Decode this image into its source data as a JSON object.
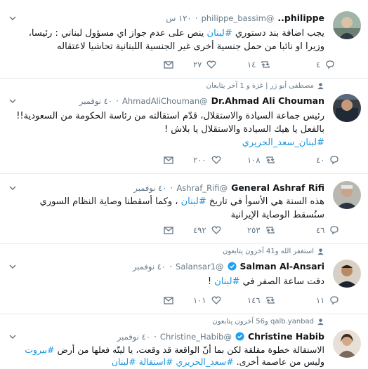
{
  "tweets": [
    {
      "name": "philippe..",
      "handle": "@philippe_bassim",
      "time": "١٢٠ س",
      "text": "يجب اضافة بند دستوري #لبنان ينص على عدم جواز اي مسؤول لبناني : رئيسا، وزيرا او نائبا من حمل جنسية أخرى غير الجنسية اللبنانية تحاشيا لاعتقاله",
      "hashtag": "#لبنان",
      "text_before": "يجب اضافة بند دستوري ",
      "text_after": " ينص على عدم جواز اي مسؤول لبناني : رئيسا، وزيرا او نائبا من حمل جنسية أخرى غير الجنسية اللبنانية تحاشيا لاعتقاله",
      "replies": "٤",
      "retweets": "١٤",
      "likes": "٢٧"
    },
    {
      "social": "مصطفى أبو زر | غزة و 1 آخر يتابعان",
      "name": "Dr.Ahmad Ali Chouman",
      "handle": "@AhmadAliChouman",
      "time": "٤٠ نوفمبر",
      "line1": "رئيس جماعة السيادة والاستقلال، قدّم استقالته من رئاسة الحكومة من السعودية!!",
      "line2": "بالفعل يا هيك السيادة والاستقلال يا بلاش !",
      "hashtags": "#لبنان_سعد_الحريري",
      "replies": "٤٠",
      "retweets": "١٠٨",
      "likes": "٢٠٠"
    },
    {
      "name": "General Ashraf Rifi",
      "handle": "@Ashraf_Rifi",
      "time": "٤٠ نوفمبر",
      "line1_before": "هذه السنة هي الأسوأ في تاريخ ",
      "line1_hashtag": "#لبنان",
      "line1_after": " ، وكما أسقطنا وصاية النظام السوري",
      "line2": "سنُسقط الوصاية الإيرانية",
      "replies": "٤٦",
      "retweets": "٢٥٣",
      "likes": "٤٩٢"
    },
    {
      "social": "استغفر الله و41 آخرون يتابعون",
      "name": "Salman Al-Ansari",
      "handle": "@Salansar1",
      "time": "٤٠ نوفمبر",
      "text_before": "دقت ساعة الصفر في ",
      "hashtag": "#لبنان",
      "text_after": " !",
      "replies": "١١",
      "retweets": "١٤٦",
      "likes": "١٠١"
    },
    {
      "social": "qalb.yanbad و56 آخرون يتابعون",
      "name": "Christine Habib",
      "handle": "@Christine_Habib",
      "time": "٤٠ نوفمبر",
      "line1_before": "الاستقالة خطوة مقلقة لكن بما أنّ الواقعة قد وقعت، يا ليتّه فعلها من أرض ",
      "line1_hashtag": "#بيروت",
      "line2_before": "وليس من عاصمة أخرى. ",
      "line2_hashtags": "#سعد_الحريري #استقالة #لبنان"
    }
  ]
}
